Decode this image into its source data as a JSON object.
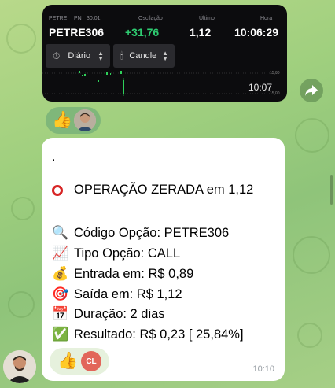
{
  "trade_image": {
    "ticker_label": "PETRE",
    "type_label": "PN",
    "strike_label": "30,01",
    "ticker": "PETRE306",
    "oscillation_label": "Oscilação",
    "oscillation": "+31,76",
    "last_label": "Último",
    "last": "1,12",
    "time_label": "Hora",
    "time": "10:06:29",
    "period_select": "Diário",
    "chart_type_select": "Candle",
    "chart_time": "10:07",
    "price_high": "15,00",
    "price_low": "15,00",
    "colors": {
      "oscillation": "#2ecc71",
      "candle": "#2fd05a"
    }
  },
  "reactions_top": {
    "emoji": "👍"
  },
  "message": {
    "dot": ".",
    "title": "OPERAÇÃO ZERADA em 1,12",
    "lines": [
      {
        "icon": "🔍",
        "icon_name": "magnifier-icon",
        "text": "Código Opção: PETRE306"
      },
      {
        "icon": "📈",
        "icon_name": "chart-increasing-icon",
        "text": "Tipo Opção: CALL"
      },
      {
        "icon": "💰",
        "icon_name": "money-bag-icon",
        "text": "Entrada em: R$ 0,89"
      },
      {
        "icon": "🎯",
        "icon_name": "target-icon",
        "text": "Saída em: R$ 1,12"
      },
      {
        "icon": "📅",
        "icon_name": "calendar-icon",
        "text": "Duração: 2 dias"
      },
      {
        "icon": "✅",
        "icon_name": "check-mark-icon",
        "text": "Resultado: R$ 0,23 [ 25,84%]"
      }
    ],
    "reaction_emoji": "👍",
    "reaction_initials": "CL",
    "time": "10:10"
  }
}
